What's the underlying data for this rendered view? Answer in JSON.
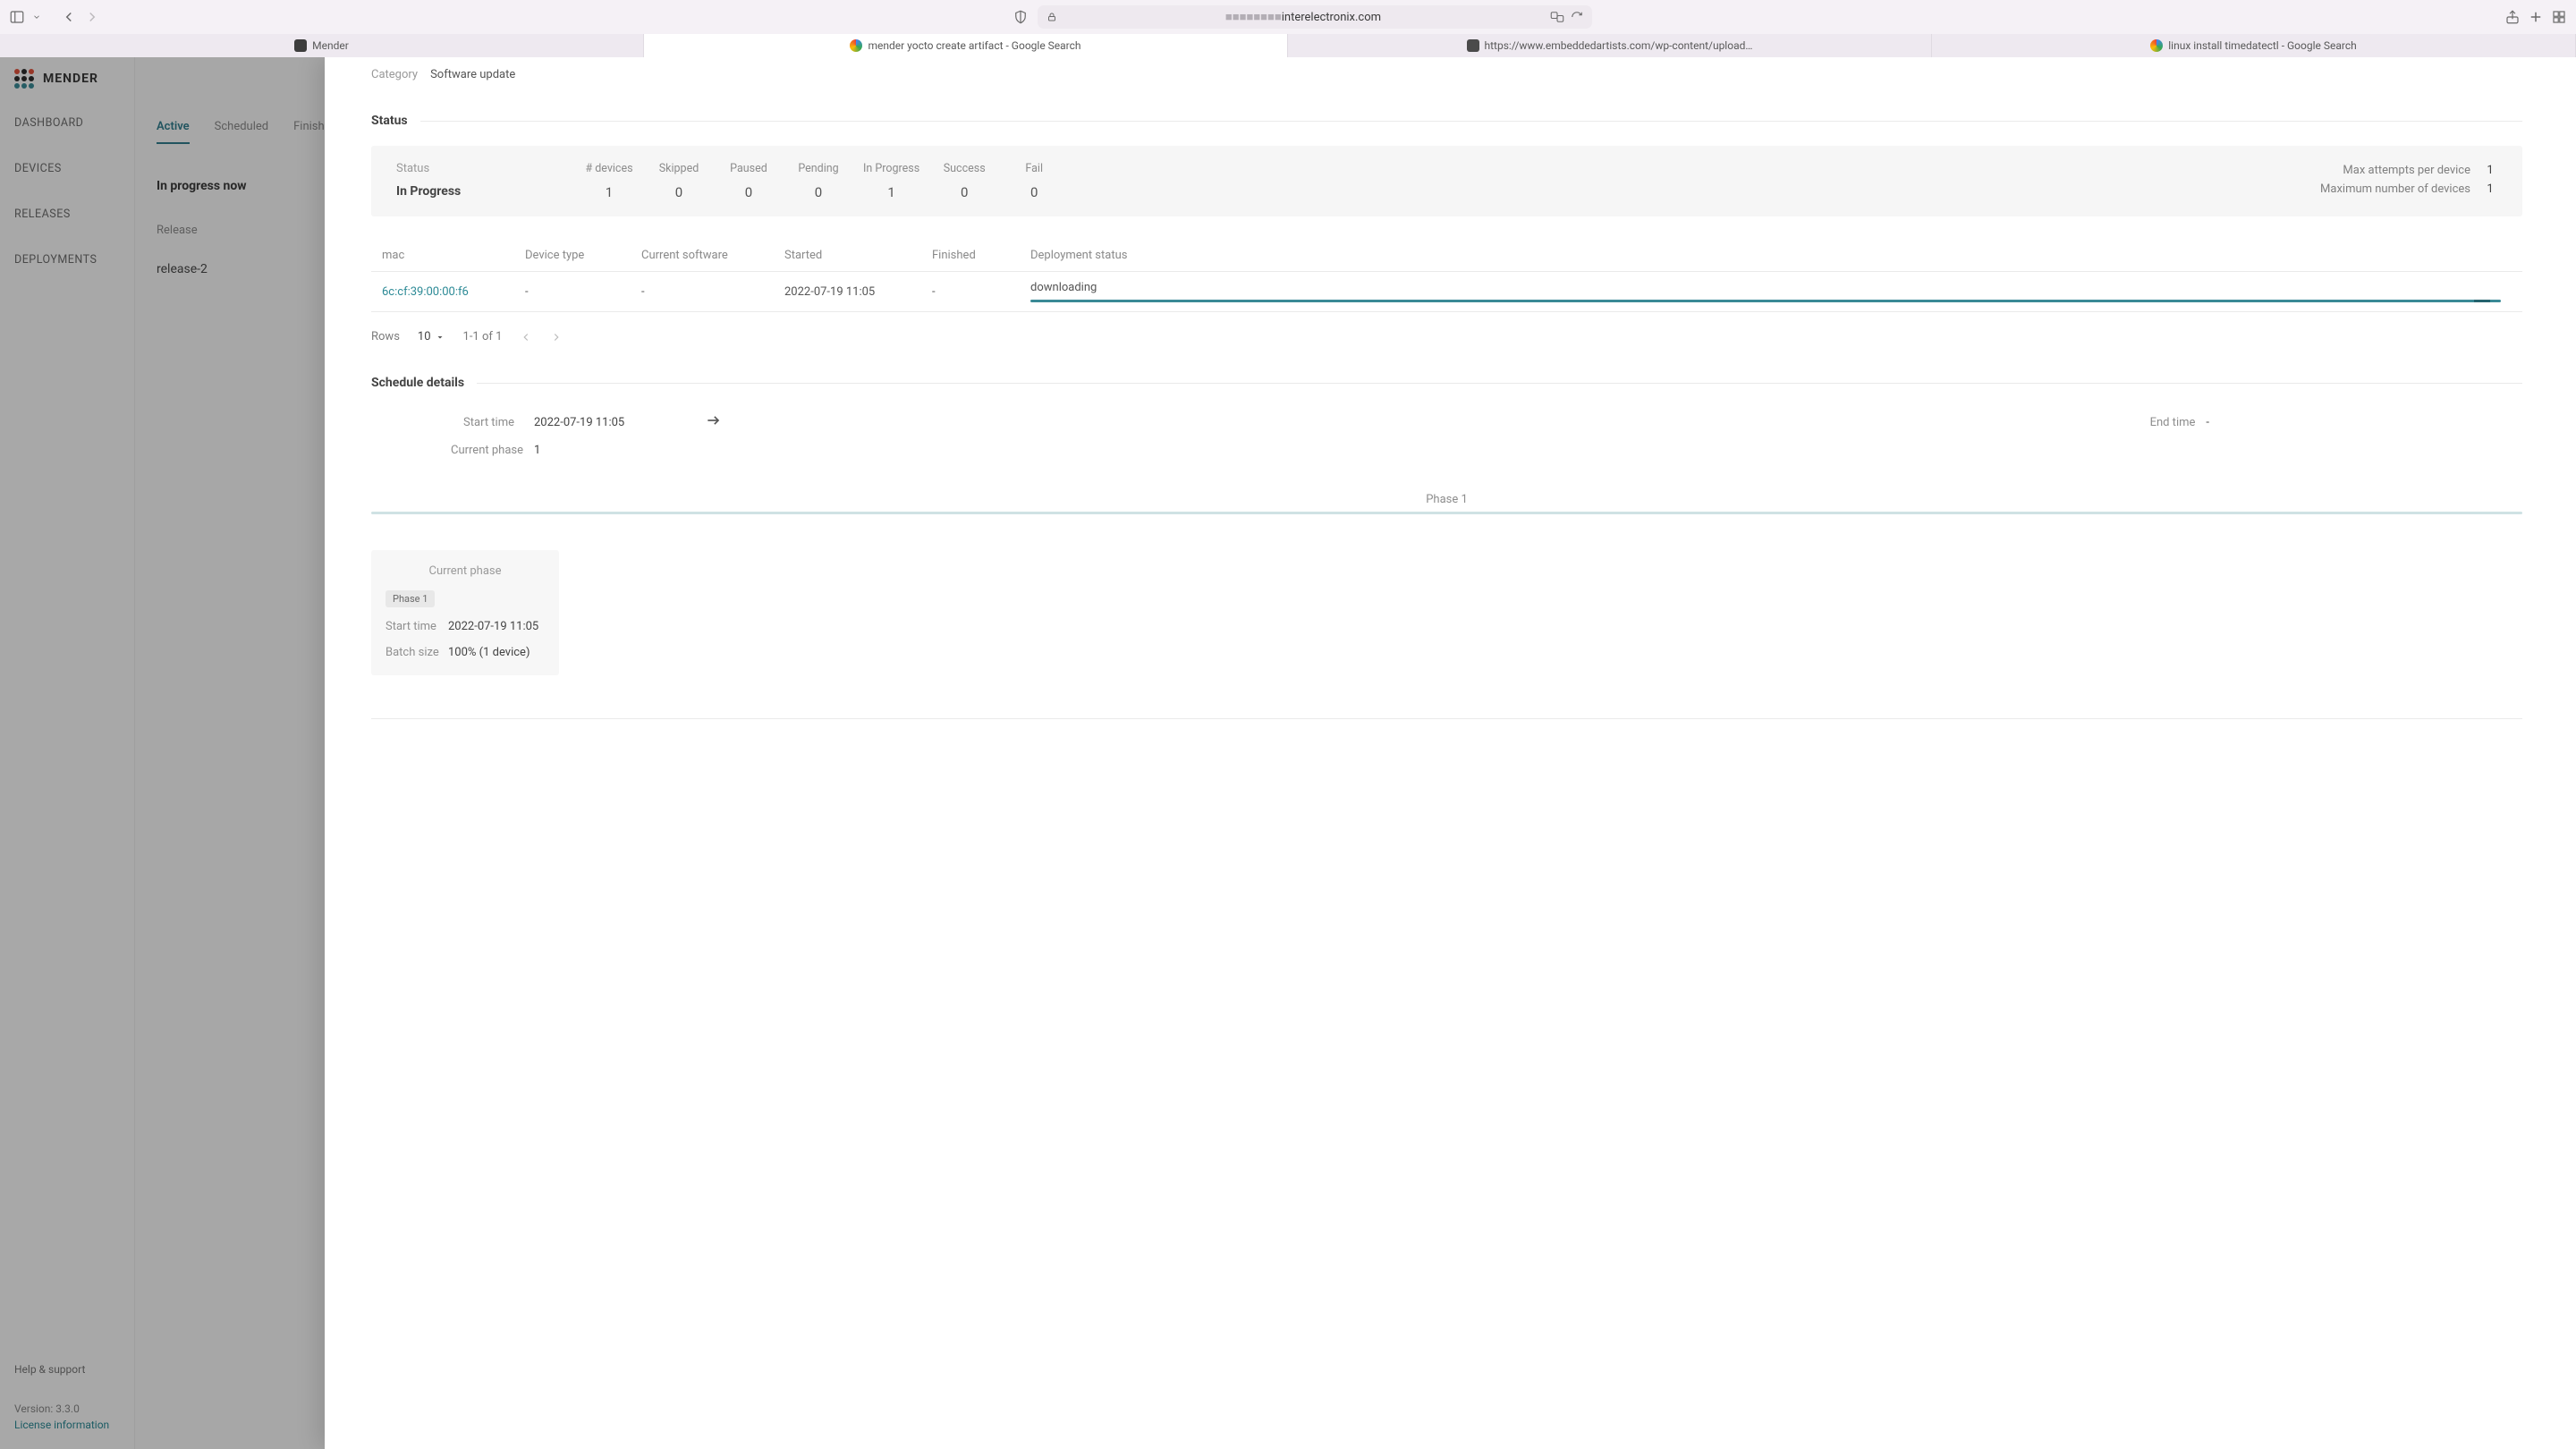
{
  "browser": {
    "url_host_muted": "",
    "url_host_main": "interelectronix.com",
    "tabs": [
      {
        "label": "Mender"
      },
      {
        "label": "mender yocto create artifact - Google Search"
      },
      {
        "label": "https://www.embeddedartists.com/wp-content/uploads/2021/01/iMX_OTA_Upd..."
      },
      {
        "label": "linux install timedatectl - Google Search"
      }
    ],
    "active_tab_index": 1
  },
  "sidebar": {
    "logo_text": "MENDER",
    "items": [
      "DASHBOARD",
      "DEVICES",
      "RELEASES",
      "DEPLOYMENTS"
    ],
    "help_label": "Help & support",
    "version_label": "Version: 3.3.0",
    "license_label": "License information"
  },
  "middle": {
    "tabs": [
      "Active",
      "Scheduled",
      "Finish"
    ],
    "heading": "In progress now",
    "release_label": "Release",
    "release_value": "release-2"
  },
  "panel": {
    "category_label": "Category",
    "category_value": "Software update",
    "status_section_title": "Status",
    "status_label": "Status",
    "status_value": "In Progress",
    "counts": {
      "headers": [
        "# devices",
        "Skipped",
        "Paused",
        "Pending",
        "In Progress",
        "Success",
        "Fail"
      ],
      "values": [
        "1",
        "0",
        "0",
        "0",
        "1",
        "0",
        "0"
      ]
    },
    "max_attempts_label": "Max attempts per device",
    "max_attempts_value": "1",
    "max_devices_label": "Maximum number of devices",
    "max_devices_value": "1",
    "table": {
      "headers": {
        "mac": "mac",
        "device_type": "Device type",
        "current_software": "Current software",
        "started": "Started",
        "finished": "Finished",
        "deployment_status": "Deployment status"
      },
      "row": {
        "mac": "6c:cf:39:00:00:f6",
        "device_type": "-",
        "current_software": "-",
        "started": "2022-07-19 11:05",
        "finished": "-",
        "deployment_status": "downloading"
      }
    },
    "pager": {
      "rows_label": "Rows",
      "rows_value": "10",
      "range": "1-1 of 1"
    },
    "schedule_section_title": "Schedule details",
    "start_time_label": "Start time",
    "start_time_value": "2022-07-19 11:05",
    "end_time_label": "End time",
    "end_time_value": "-",
    "current_phase_label": "Current phase",
    "current_phase_value": "1",
    "phase_strip_label": "Phase 1",
    "phase_card": {
      "header": "Current phase",
      "pill": "Phase 1",
      "start_time_label": "Start time",
      "start_time_value": "2022-07-19 11:05",
      "batch_label": "Batch size",
      "batch_value": "100% (1 device)"
    }
  }
}
